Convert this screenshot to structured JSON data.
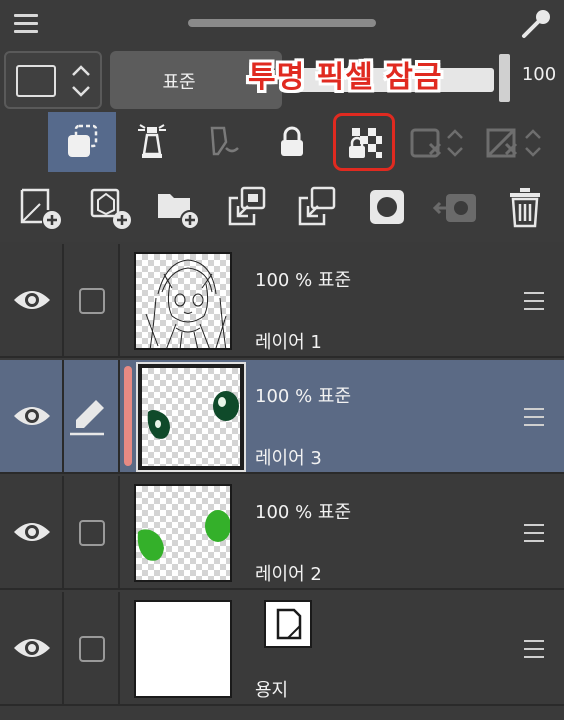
{
  "top_bar": {
    "menu_icon": "hamburger-icon",
    "drag_handle_icon": "grabber",
    "eyedropper_icon": "eyedropper-icon"
  },
  "layer_property": {
    "blend_mode": "표준",
    "opacity_value": "100",
    "opacity_fraction": 1.0
  },
  "callout": {
    "text": "투명 픽셀 잠금",
    "color": "#e02a20"
  },
  "toggle_buttons": [
    {
      "icon": "clipping-icon",
      "active": true
    },
    {
      "icon": "reference-layer-icon",
      "active": false
    },
    {
      "icon": "draft-layer-icon",
      "active": false
    },
    {
      "icon": "lock-icon",
      "active": false
    },
    {
      "icon": "lock-transparent-pixels-icon",
      "active": false,
      "highlighted": true
    },
    {
      "icon": "mask-on-layer-icon",
      "active": false
    },
    {
      "icon": "ruler-on-layer-icon",
      "active": false
    }
  ],
  "action_buttons": [
    {
      "icon": "new-raster-layer-icon"
    },
    {
      "icon": "new-vector-layer-icon"
    },
    {
      "icon": "new-folder-icon"
    },
    {
      "icon": "transfer-to-lower-layer-icon"
    },
    {
      "icon": "merge-with-layer-below-icon"
    },
    {
      "icon": "create-layer-mask-icon"
    },
    {
      "icon": "apply-mask-icon"
    },
    {
      "icon": "delete-layer-icon"
    }
  ],
  "layers": [
    {
      "mode": "100 % 표준",
      "name": "레이어 1",
      "selected": false,
      "thumb": "line-art"
    },
    {
      "mode": "100 % 표준",
      "name": "레이어 3",
      "selected": true,
      "thumb": "dark-green-eyes"
    },
    {
      "mode": "100 % 표준",
      "name": "레이어 2",
      "selected": false,
      "thumb": "light-green-spots"
    },
    {
      "mode": "",
      "name": "용지",
      "selected": false,
      "thumb": "paper"
    }
  ],
  "colors": {
    "accent_selected_row": "#5b6a85",
    "active_button": "#566a8c",
    "selection_bar": "#e78a83",
    "dark_green": "#0f4a2a",
    "light_green": "#34b02a"
  }
}
